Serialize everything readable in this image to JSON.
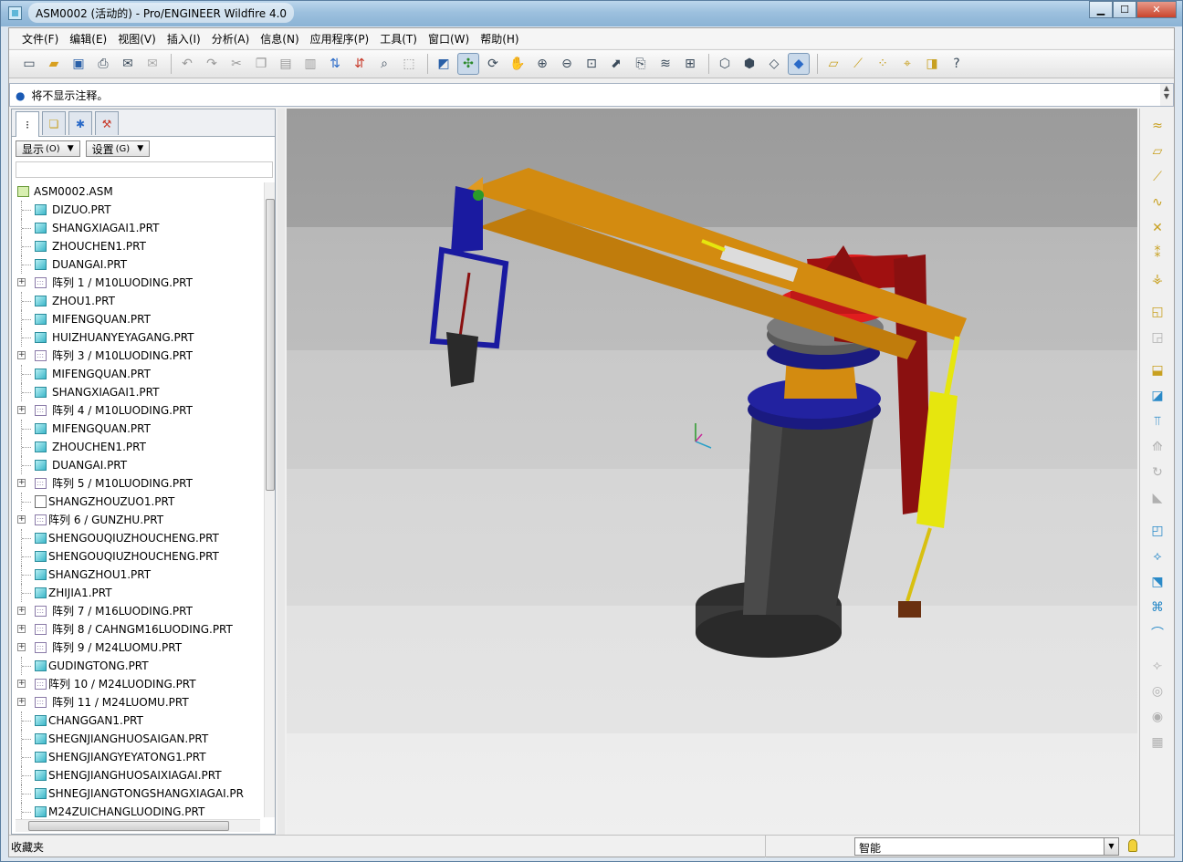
{
  "window": {
    "title": "ASM0002 (活动的) - Pro/ENGINEER Wildfire 4.0",
    "controls": {
      "minimize": "▁",
      "maximize": "☐",
      "close": "✕"
    }
  },
  "menubar": {
    "items": [
      {
        "label": "文件(F)"
      },
      {
        "label": "编辑(E)"
      },
      {
        "label": "视图(V)"
      },
      {
        "label": "插入(I)"
      },
      {
        "label": "分析(A)"
      },
      {
        "label": "信息(N)"
      },
      {
        "label": "应用程序(P)"
      },
      {
        "label": "工具(T)"
      },
      {
        "label": "窗口(W)"
      },
      {
        "label": "帮助(H)"
      }
    ]
  },
  "toolbar": {
    "icons": [
      "new-file-icon",
      "open-folder-icon",
      "save-icon",
      "print-icon",
      "email-icon",
      "email-link-icon",
      "undo-icon",
      "redo-icon",
      "cut-icon",
      "copy-icon",
      "paste-icon",
      "paste-special-icon",
      "regenerate-icon",
      "regen-manager-icon",
      "find-icon",
      "select-box-icon",
      "repaint-icon",
      "spin-center-icon",
      "orient-icon",
      "pan-icon",
      "zoom-in-icon",
      "zoom-out-icon",
      "refit-icon",
      "reorient-icon",
      "saved-views-icon",
      "layers-icon",
      "view-manager-icon",
      "wireframe-icon",
      "hidden-line-icon",
      "no-hidden-icon",
      "shading-icon",
      "datum-planes-icon",
      "datum-axes-icon",
      "datum-points-icon",
      "csys-icon",
      "annotation-icon",
      "context-help-icon"
    ]
  },
  "message": {
    "text": "将不显示注释。"
  },
  "model_tree": {
    "tabs": [
      "model-tree-tab",
      "layer-tree-tab",
      "favorites-tab",
      "connections-tab"
    ],
    "show_label": "显示",
    "show_key": "(O)",
    "settings_label": "设置",
    "settings_key": "(G)",
    "root": "ASM0002.ASM",
    "items": [
      {
        "label": "DIZUO.PRT",
        "type": "part"
      },
      {
        "label": "SHANGXIAGAI1.PRT",
        "type": "part"
      },
      {
        "label": "ZHOUCHEN1.PRT",
        "type": "part"
      },
      {
        "label": "DUANGAI.PRT",
        "type": "part"
      },
      {
        "label": "阵列 1 / M10LUODING.PRT",
        "type": "pattern"
      },
      {
        "label": "ZHOU1.PRT",
        "type": "part"
      },
      {
        "label": "MIFENGQUAN.PRT",
        "type": "part"
      },
      {
        "label": "HUIZHUANYEYAGANG.PRT",
        "type": "part"
      },
      {
        "label": "阵列 3 / M10LUODING.PRT",
        "type": "pattern"
      },
      {
        "label": "MIFENGQUAN.PRT",
        "type": "part"
      },
      {
        "label": "SHANGXIAGAI1.PRT",
        "type": "part"
      },
      {
        "label": "阵列 4 / M10LUODING.PRT",
        "type": "pattern"
      },
      {
        "label": "MIFENGQUAN.PRT",
        "type": "part"
      },
      {
        "label": "ZHOUCHEN1.PRT",
        "type": "part"
      },
      {
        "label": "DUANGAI.PRT",
        "type": "part"
      },
      {
        "label": "阵列 5 / M10LUODING.PRT",
        "type": "pattern"
      },
      {
        "label": "SHANGZHOUZUO1.PRT",
        "type": "part-flagged"
      },
      {
        "label": "阵列 6 / GUNZHU.PRT",
        "type": "pattern-flagged"
      },
      {
        "label": "SHENGOUQIUZHOUCHENG.PRT",
        "type": "part-flagged"
      },
      {
        "label": "SHENGOUQIUZHOUCHENG.PRT",
        "type": "part-flagged"
      },
      {
        "label": "SHANGZHOU1.PRT",
        "type": "part-flagged"
      },
      {
        "label": "ZHIJIA1.PRT",
        "type": "part-flagged"
      },
      {
        "label": "阵列 7 / M16LUODING.PRT",
        "type": "pattern"
      },
      {
        "label": "阵列 8 / CAHNGM16LUODING.PRT",
        "type": "pattern"
      },
      {
        "label": "阵列 9 / M24LUOMU.PRT",
        "type": "pattern"
      },
      {
        "label": "GUDINGTONG.PRT",
        "type": "part-flagged"
      },
      {
        "label": "阵列 10 / M24LUODING.PRT",
        "type": "pattern-flagged"
      },
      {
        "label": "阵列 11 / M24LUOMU.PRT",
        "type": "pattern"
      },
      {
        "label": "CHANGGAN1.PRT",
        "type": "part-flagged"
      },
      {
        "label": "SHEGNJIANGHUOSAIGAN.PRT",
        "type": "part-flagged"
      },
      {
        "label": "SHENGJIANGYEYATONG1.PRT",
        "type": "part-flagged"
      },
      {
        "label": "SHENGJIANGHUOSAIXIAGAI.PRT",
        "type": "part-flagged"
      },
      {
        "label": "SHNEGJIANGTONGSHANGXIAGAI.PR",
        "type": "part-flagged"
      },
      {
        "label": "M24ZUICHANGLUODING.PRT",
        "type": "part-flagged"
      }
    ]
  },
  "right_toolbar": {
    "icons": [
      "datum-plane-icon",
      "datum-axis-icon",
      "datum-curve-icon",
      "datum-point-icon",
      "offset-point-icon",
      "field-point-icon",
      "datum-csys-icon",
      "assemble-icon",
      "create-component-icon",
      "extrude-icon",
      "revolve-icon",
      "sweep-icon",
      "blend-icon",
      "hole-icon",
      "round-icon",
      "chamfer-icon",
      "shell-icon",
      "draft-icon",
      "rib-icon",
      "pattern-icon",
      "mirror-icon",
      "merge-icon",
      "trim-icon",
      "offset-icon",
      "thicken-icon"
    ]
  },
  "status": {
    "favorites_label": "收藏夹",
    "filter_value": "智能"
  },
  "colors": {
    "boom": "#d38b10",
    "base": "#3a3a3a",
    "flange": "#e01e1e",
    "flange_dark": "#a01010",
    "cylinder": "#e6e60e",
    "bolt_ring": "#1a1a80",
    "gripper": "#1a1aa0"
  }
}
